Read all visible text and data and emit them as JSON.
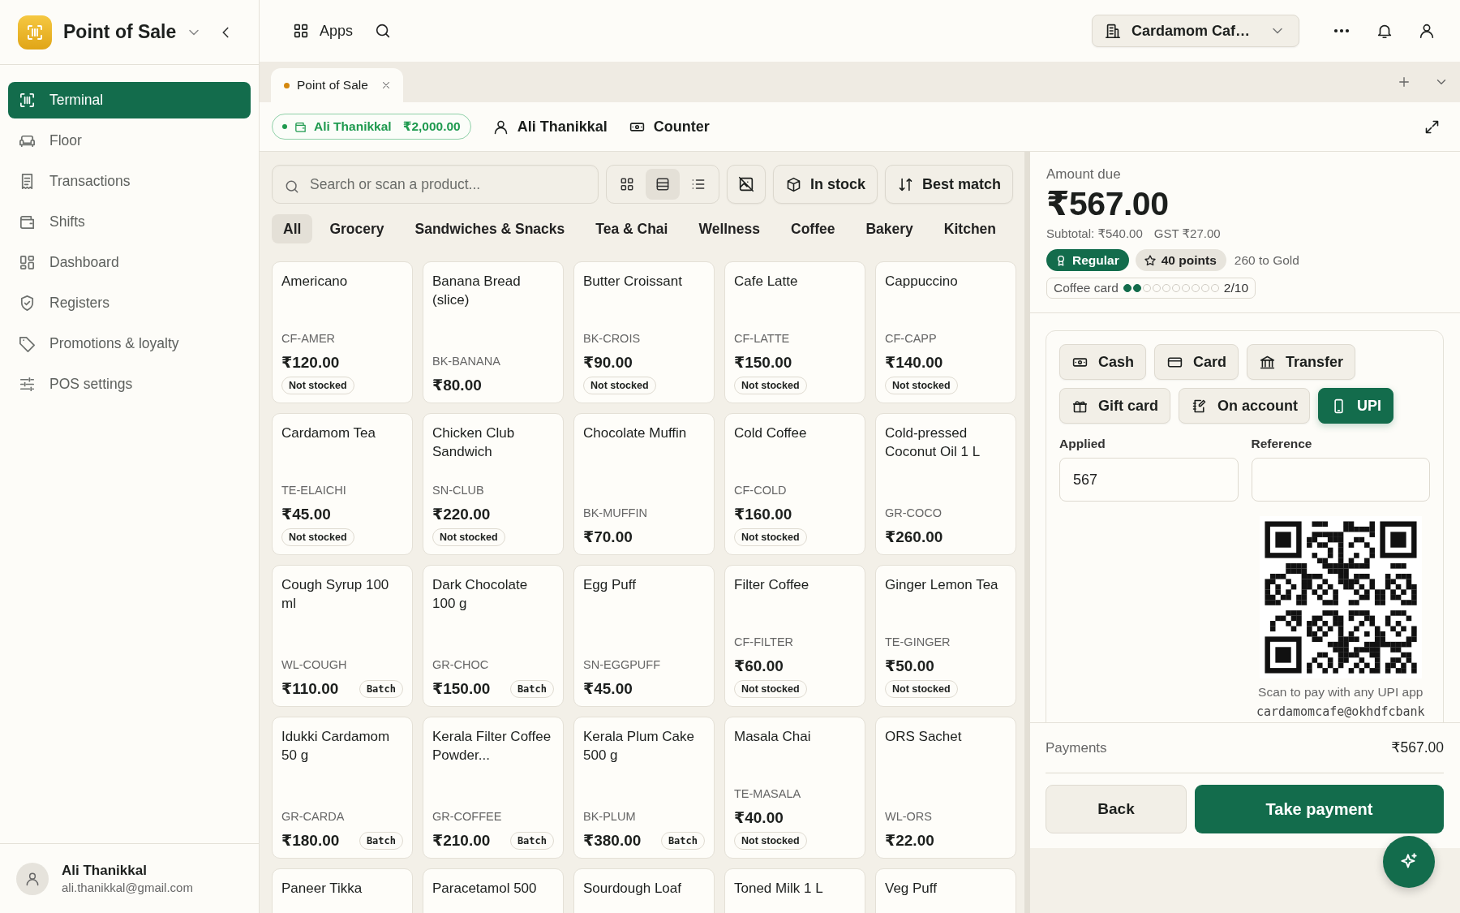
{
  "sidebar": {
    "app_title": "Point of Sale",
    "items": [
      {
        "label": "Terminal",
        "selected": true
      },
      {
        "label": "Floor",
        "selected": false
      },
      {
        "label": "Transactions",
        "selected": false
      },
      {
        "label": "Shifts",
        "selected": false
      },
      {
        "label": "Dashboard",
        "selected": false
      },
      {
        "label": "Registers",
        "selected": false
      },
      {
        "label": "Promotions & loyalty",
        "selected": false
      },
      {
        "label": "POS settings",
        "selected": false
      }
    ],
    "user": {
      "name": "Ali Thanikkal",
      "email": "ali.thanikkal@gmail.com"
    }
  },
  "topbar": {
    "apps_label": "Apps",
    "store": "Cardamom Caf…"
  },
  "tabs": [
    {
      "label": "Point of Sale",
      "selected": true
    }
  ],
  "session": {
    "cashier": {
      "name": "Ali Thanikkal",
      "amount": "₹2,000.00"
    },
    "customer": "Ali Thanikkal",
    "register": "Counter"
  },
  "products": {
    "search": {
      "placeholder": "Search or scan a product..."
    },
    "view_modes": [
      {
        "selected": false
      },
      {
        "selected": true
      },
      {
        "selected": false
      }
    ],
    "filters": [
      "In stock",
      "Best match"
    ],
    "categories": [
      {
        "label": "All",
        "selected": true
      },
      {
        "label": "Grocery",
        "selected": false
      },
      {
        "label": "Sandwiches & Snacks",
        "selected": false
      },
      {
        "label": "Tea & Chai",
        "selected": false
      },
      {
        "label": "Wellness",
        "selected": false
      },
      {
        "label": "Coffee",
        "selected": false
      },
      {
        "label": "Bakery",
        "selected": false
      },
      {
        "label": "Kitchen",
        "selected": false
      }
    ],
    "items": [
      {
        "name": "Americano",
        "sku": "CF-AMER",
        "price": "₹120.00",
        "badge": {
          "kind": "stock",
          "text": "Not stocked"
        }
      },
      {
        "name": "Banana Bread (slice)",
        "sku": "BK-BANANA",
        "price": "₹80.00"
      },
      {
        "name": "Butter Croissant",
        "sku": "BK-CROIS",
        "price": "₹90.00",
        "badge": {
          "kind": "stock",
          "text": "Not stocked"
        }
      },
      {
        "name": "Cafe Latte",
        "sku": "CF-LATTE",
        "price": "₹150.00",
        "badge": {
          "kind": "stock",
          "text": "Not stocked"
        }
      },
      {
        "name": "Cappuccino",
        "sku": "CF-CAPP",
        "price": "₹140.00",
        "badge": {
          "kind": "stock",
          "text": "Not stocked"
        }
      },
      {
        "name": "Cardamom Tea",
        "sku": "TE-ELAICHI",
        "price": "₹45.00",
        "badge": {
          "kind": "stock",
          "text": "Not stocked"
        }
      },
      {
        "name": "Chicken Club Sandwich",
        "sku": "SN-CLUB",
        "price": "₹220.00",
        "badge": {
          "kind": "stock",
          "text": "Not stocked"
        }
      },
      {
        "name": "Chocolate Muffin",
        "sku": "BK-MUFFIN",
        "price": "₹70.00"
      },
      {
        "name": "Cold Coffee",
        "sku": "CF-COLD",
        "price": "₹160.00",
        "badge": {
          "kind": "stock",
          "text": "Not stocked"
        }
      },
      {
        "name": "Cold-pressed Coconut Oil 1 L",
        "sku": "GR-COCO",
        "price": "₹260.00"
      },
      {
        "name": "Cough Syrup 100 ml",
        "sku": "WL-COUGH",
        "price": "₹110.00",
        "badge": {
          "kind": "batch",
          "text": "Batch"
        }
      },
      {
        "name": "Dark Chocolate 100 g",
        "sku": "GR-CHOC",
        "price": "₹150.00",
        "badge": {
          "kind": "batch",
          "text": "Batch"
        }
      },
      {
        "name": "Egg Puff",
        "sku": "SN-EGGPUFF",
        "price": "₹45.00"
      },
      {
        "name": "Filter Coffee",
        "sku": "CF-FILTER",
        "price": "₹60.00",
        "badge": {
          "kind": "stock",
          "text": "Not stocked"
        }
      },
      {
        "name": "Ginger Lemon Tea",
        "sku": "TE-GINGER",
        "price": "₹50.00",
        "badge": {
          "kind": "stock",
          "text": "Not stocked"
        }
      },
      {
        "name": "Idukki Cardamom 50 g",
        "sku": "GR-CARDA",
        "price": "₹180.00",
        "badge": {
          "kind": "batch",
          "text": "Batch"
        }
      },
      {
        "name": "Kerala Filter Coffee Powder...",
        "sku": "GR-COFFEE",
        "price": "₹210.00",
        "badge": {
          "kind": "batch",
          "text": "Batch"
        }
      },
      {
        "name": "Kerala Plum Cake 500 g",
        "sku": "BK-PLUM",
        "price": "₹380.00",
        "badge": {
          "kind": "batch",
          "text": "Batch"
        }
      },
      {
        "name": "Masala Chai",
        "sku": "TE-MASALA",
        "price": "₹40.00",
        "badge": {
          "kind": "stock",
          "text": "Not stocked"
        }
      },
      {
        "name": "ORS Sachet",
        "sku": "WL-ORS",
        "price": "₹22.00"
      },
      {
        "name": "Paneer Tikka"
      },
      {
        "name": "Paracetamol 500"
      },
      {
        "name": "Sourdough Loaf"
      },
      {
        "name": "Toned Milk 1 L"
      },
      {
        "name": "Veg Puff"
      }
    ]
  },
  "checkout": {
    "amount_label": "Amount due",
    "amount": "₹567.00",
    "subtotal": "Subtotal: ₹540.00",
    "tax": "GST ₹27.00",
    "tier": "Regular",
    "points": "40 points",
    "next_tier": "260 to Gold",
    "coffee_card": {
      "label": "Coffee card",
      "stars": 2,
      "count": "2/10"
    },
    "methods": [
      {
        "label": "Cash",
        "selected": false
      },
      {
        "label": "Card",
        "selected": false
      },
      {
        "label": "Transfer",
        "selected": false
      },
      {
        "label": "Gift card",
        "selected": false
      },
      {
        "label": "On account",
        "selected": false
      },
      {
        "label": "UPI",
        "selected": true
      }
    ],
    "applied": {
      "label": "Applied",
      "value": "567"
    },
    "reference": {
      "label": "Reference"
    },
    "qr": {
      "caption": "Scan to pay with any UPI app",
      "vpa": "cardamomcafe@okhdfcbank"
    },
    "payments": {
      "label": "Payments",
      "amount": "₹567.00"
    },
    "buttons": [
      {
        "label": "Back",
        "kind": "secondary"
      },
      {
        "label": "Take payment",
        "kind": "primary"
      }
    ]
  }
}
